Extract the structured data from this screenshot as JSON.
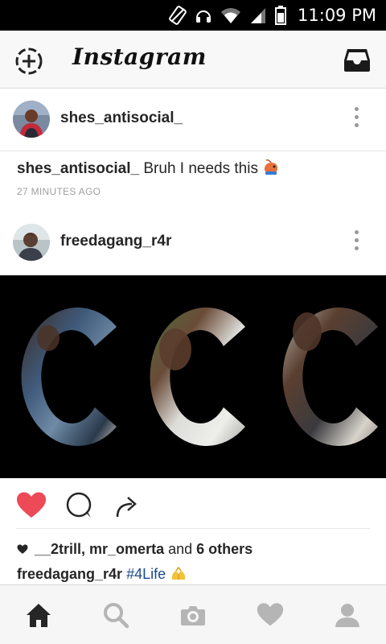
{
  "status_bar": {
    "time": "11:09 PM"
  },
  "header": {
    "logo_text": "Instagram",
    "camera_icon": "camera-add-icon",
    "inbox_icon": "inbox-icon"
  },
  "posts": [
    {
      "username": "shes_antisocial_",
      "caption_user": "shes_antisocial_",
      "caption_text": "Bruh I needs this",
      "timestamp": "27 MINUTES AGO"
    },
    {
      "username": "freedagang_r4r",
      "image_text": "CCC",
      "liked": true,
      "likes_users": "__2trill, mr_omerta",
      "likes_and": "and",
      "likes_others": "6 others",
      "caption_user": "freedagang_r4r",
      "caption_tag": "#4Life"
    }
  ],
  "bottom_nav": [
    "home-icon",
    "search-icon",
    "camera-icon",
    "activity-heart-icon",
    "profile-icon"
  ],
  "colors": {
    "like_red": "#ED4956",
    "hashtag_blue": "#1A4B8C",
    "status_bar": "#000000"
  }
}
